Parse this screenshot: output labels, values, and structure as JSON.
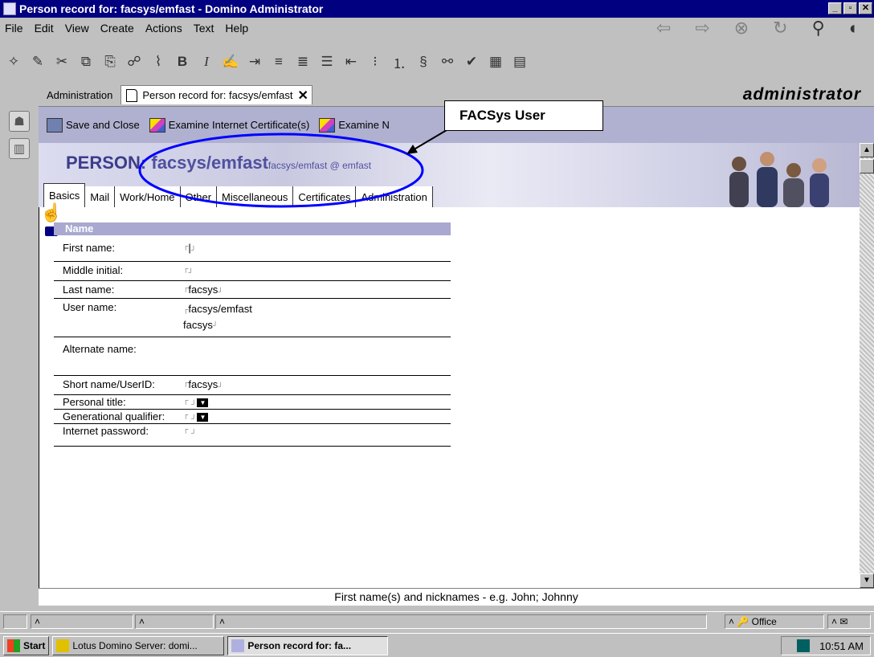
{
  "window": {
    "title": "Person record for: facsys/emfast - Domino Administrator"
  },
  "menu": [
    "File",
    "Edit",
    "View",
    "Create",
    "Actions",
    "Text",
    "Help"
  ],
  "tabs": {
    "admin": "Administration",
    "doc": "Person record for: facsys/emfast"
  },
  "brand": "administrator",
  "actions": {
    "save": "Save and Close",
    "examine_internet": "Examine Internet Certificate(s)",
    "examine_notes": "Examine N"
  },
  "callout": "FACSys User",
  "header": {
    "type": "PERSON",
    "separator": ":",
    "name": "facsys/emfast",
    "sub": "facsys/emfast @ emfast"
  },
  "doc_tabs": [
    "Basics",
    "Mail",
    "Work/Home",
    "Other",
    "Miscellaneous",
    "Certificates",
    "Administration"
  ],
  "section": "Name",
  "fields": {
    "first_name": {
      "label": "First name:",
      "value": ""
    },
    "middle_initial": {
      "label": "Middle initial:",
      "value": ""
    },
    "last_name": {
      "label": "Last name:",
      "value": "facsys"
    },
    "user_name": {
      "label": "User name:",
      "value1": "facsys/emfast",
      "value2": "facsys"
    },
    "alternate_name": {
      "label": "Alternate name:"
    },
    "short_name": {
      "label": "Short name/UserID:",
      "value": "facsys"
    },
    "personal_title": {
      "label": "Personal title:"
    },
    "gen_qualifier": {
      "label": "Generational qualifier:"
    },
    "internet_password": {
      "label": "Internet password:"
    }
  },
  "help_text": "First name(s) and nicknames - e.g. John; Johnny",
  "status": {
    "location": "Office"
  },
  "taskbar": {
    "start": "Start",
    "server": "Lotus Domino Server: domi...",
    "person": "Person record for: fa...",
    "clock": "10:51 AM"
  }
}
